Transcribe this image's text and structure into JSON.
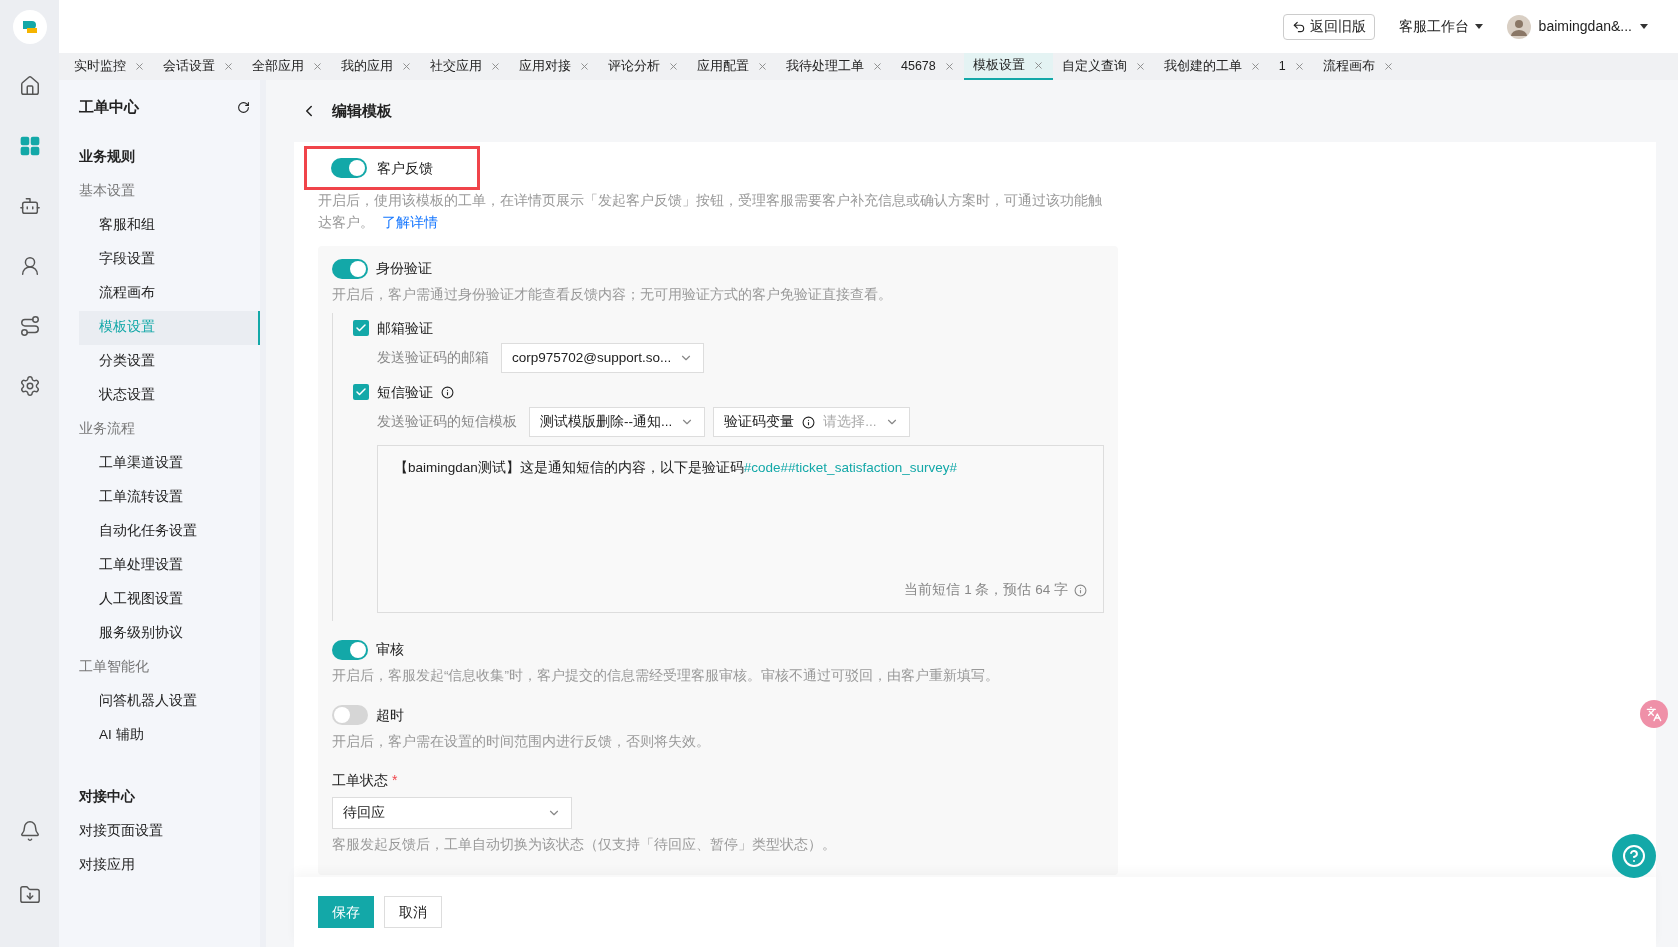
{
  "rail": {
    "items": [
      {
        "kind": "home",
        "selected": false
      },
      {
        "kind": "apps",
        "selected": true
      },
      {
        "kind": "robot",
        "selected": false
      },
      {
        "kind": "person",
        "selected": false
      },
      {
        "kind": "route",
        "selected": false
      },
      {
        "kind": "settings",
        "selected": false
      }
    ],
    "bottom": [
      {
        "kind": "bell"
      },
      {
        "kind": "download"
      }
    ]
  },
  "topbar": {
    "back_button": "返回旧版",
    "workspace": "客服工作台",
    "user": "baimingdan&..."
  },
  "tabs": [
    {
      "label": "实时监控",
      "selected": false
    },
    {
      "label": "会话设置",
      "selected": false
    },
    {
      "label": "全部应用",
      "selected": false
    },
    {
      "label": "我的应用",
      "selected": false
    },
    {
      "label": "社交应用",
      "selected": false
    },
    {
      "label": "应用对接",
      "selected": false
    },
    {
      "label": "评论分析",
      "selected": false
    },
    {
      "label": "应用配置",
      "selected": false
    },
    {
      "label": "我待处理工单",
      "selected": false
    },
    {
      "label": "45678",
      "selected": false
    },
    {
      "label": "模板设置",
      "selected": true
    },
    {
      "label": "自定义查询",
      "selected": false
    },
    {
      "label": "我创建的工单",
      "selected": false
    },
    {
      "label": "1",
      "selected": false
    },
    {
      "label": "流程画布",
      "selected": false
    }
  ],
  "sidebar": {
    "title": "工单中心",
    "sections": [
      {
        "title": "业务规则",
        "groups": [
          {
            "title": "基本设置",
            "items": [
              {
                "label": "客服和组",
                "selected": false
              },
              {
                "label": "字段设置",
                "selected": false
              },
              {
                "label": "流程画布",
                "selected": false
              },
              {
                "label": "模板设置",
                "selected": true
              },
              {
                "label": "分类设置",
                "selected": false
              },
              {
                "label": "状态设置",
                "selected": false
              }
            ]
          },
          {
            "title": "业务流程",
            "items": [
              {
                "label": "工单渠道设置",
                "selected": false
              },
              {
                "label": "工单流转设置",
                "selected": false
              },
              {
                "label": "自动化任务设置",
                "selected": false
              },
              {
                "label": "工单处理设置",
                "selected": false
              },
              {
                "label": "人工视图设置",
                "selected": false
              },
              {
                "label": "服务级别协议",
                "selected": false
              }
            ]
          },
          {
            "title": "工单智能化",
            "items": [
              {
                "label": "问答机器人设置",
                "selected": false
              },
              {
                "label": "AI 辅助",
                "selected": false
              }
            ]
          }
        ]
      },
      {
        "title": "对接中心",
        "items": [
          {
            "label": "对接页面设置",
            "selected": false
          },
          {
            "label": "对接应用",
            "selected": false
          }
        ]
      }
    ]
  },
  "page": {
    "title": "编辑模板"
  },
  "feedback": {
    "label": "客户反馈",
    "on": true,
    "highlighted": true,
    "description": "开启后，使用该模板的工单，在详情页展示「发起客户反馈」按钮，受理客服需要客户补充信息或确认方案时，可通过该功能触达客户。",
    "link": "了解详情"
  },
  "identity": {
    "label": "身份验证",
    "on": true,
    "description": "开启后，客户需通过身份验证才能查看反馈内容；无可用验证方式的客户免验证直接查看。",
    "methods": [
      {
        "label": "邮箱验证",
        "checked": true,
        "info": false,
        "field_label": "发送验证码的邮箱",
        "selects": [
          {
            "value": "corp975702@support.so..."
          }
        ]
      },
      {
        "label": "短信验证",
        "checked": true,
        "info": true,
        "field_label": "发送验证码的短信模板",
        "selects": [
          {
            "value": "测试模版删除--通知..."
          },
          {
            "prefix": "验证码变量",
            "placeholder": "请选择..."
          }
        ]
      }
    ],
    "sms": {
      "text": "【baimingdan测试】这是通知短信的内容，以下是验证码",
      "variable": "#code##ticket_satisfaction_survey#",
      "counter": "当前短信 1 条，预估 64 字"
    }
  },
  "options": [
    {
      "label": "审核",
      "on": true,
      "description": "开启后，客服发起“信息收集”时，客户提交的信息需经受理客服审核。审核不通过可驳回，由客户重新填写。"
    },
    {
      "label": "超时",
      "on": false,
      "description": "开启后，客户需在设置的时间范围内进行反馈，否则将失效。"
    }
  ],
  "status_field": {
    "label": "工单状态",
    "required": "*",
    "value": "待回应",
    "hint": "客服发起反馈后，工单自动切换为该状态（仅支持「待回应、暂停」类型状态）。"
  },
  "buttons": {
    "save": "保存",
    "cancel": "取消"
  }
}
